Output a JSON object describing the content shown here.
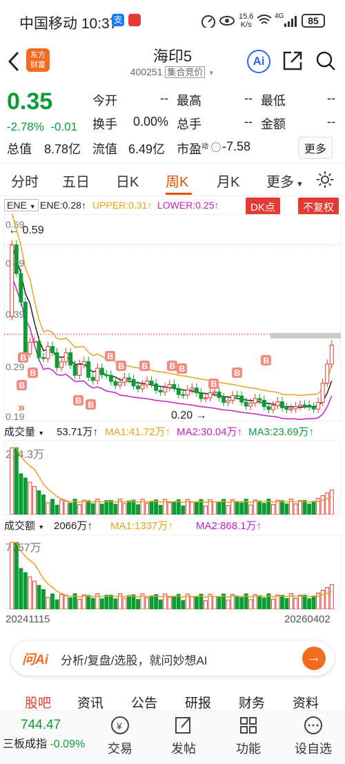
{
  "status": {
    "carrier_time": "中国移动 10:37",
    "net_speed_top": "15.6",
    "net_speed_bottom": "K/s",
    "signal": "4G",
    "battery": "85"
  },
  "nav": {
    "logo_line1": "东方",
    "logo_line2": "财富",
    "stock_name": "海印5",
    "stock_code": "400251",
    "stock_mode": "集合竞价",
    "ai_label": "Ai"
  },
  "quote": {
    "price": "0.35",
    "change_pct": "-2.78%",
    "change_abs": "-0.01",
    "rows": [
      [
        {
          "label": "今开",
          "value": "--"
        },
        {
          "label": "最高",
          "value": "--"
        },
        {
          "label": "最低",
          "value": "--"
        }
      ],
      [
        {
          "label": "换手",
          "value": "0.00%"
        },
        {
          "label": "总手",
          "value": "--"
        },
        {
          "label": "金额",
          "value": "--"
        }
      ]
    ],
    "total_value_label": "总值",
    "total_value": "8.78亿",
    "float_value_label": "流值",
    "float_value": "6.49亿",
    "pe_label": "市盈",
    "pe_sup": "动",
    "pe_value": "-7.58",
    "more_label": "更多"
  },
  "tabs": [
    "分时",
    "五日",
    "日K",
    "周K",
    "月K",
    "更多"
  ],
  "active_tab": 3,
  "indicator": {
    "name": "ENE",
    "ene": "ENE:0.28",
    "upper": "UPPER:0.31",
    "lower": "LOWER:0.25",
    "dk_label": "DK点",
    "fq_label": "不复权",
    "price_labels": [
      "0.59",
      "0.49",
      "0.39",
      "0.29",
      "0.19"
    ],
    "high_marker": "0.59",
    "low_marker": "0.20"
  },
  "volume": {
    "selector": "成交量",
    "value": "53.71万",
    "ma1": "MA1:41.72万",
    "ma2": "MA2:30.04万",
    "ma3": "MA3:23.69万",
    "max_label": "204.3万"
  },
  "amount": {
    "selector": "成交额",
    "value": "2066万",
    "ma1": "MA1:1337万",
    "ma2": "MA2:868.1万",
    "max_label": "7757万"
  },
  "dates": {
    "start": "20241115",
    "end": "20260402"
  },
  "ai_bar": {
    "brand": "问Ai",
    "text": "分析/复盘/选股，就问妙想AI"
  },
  "bottom_tabs": [
    "股吧",
    "资讯",
    "公告",
    "研报",
    "财务",
    "资料"
  ],
  "bottom_nav": {
    "index_value": "744.47",
    "index_name": "三板成指",
    "index_change": "-0.09%",
    "items": [
      "交易",
      "发帖",
      "功能",
      "设自选"
    ]
  },
  "colors": {
    "up": "#e53935",
    "down": "#0a9d34",
    "accent": "#e65100",
    "ma1": "#e8a317",
    "ma2": "#c81ec8",
    "ma3": "#0a9d34"
  }
}
